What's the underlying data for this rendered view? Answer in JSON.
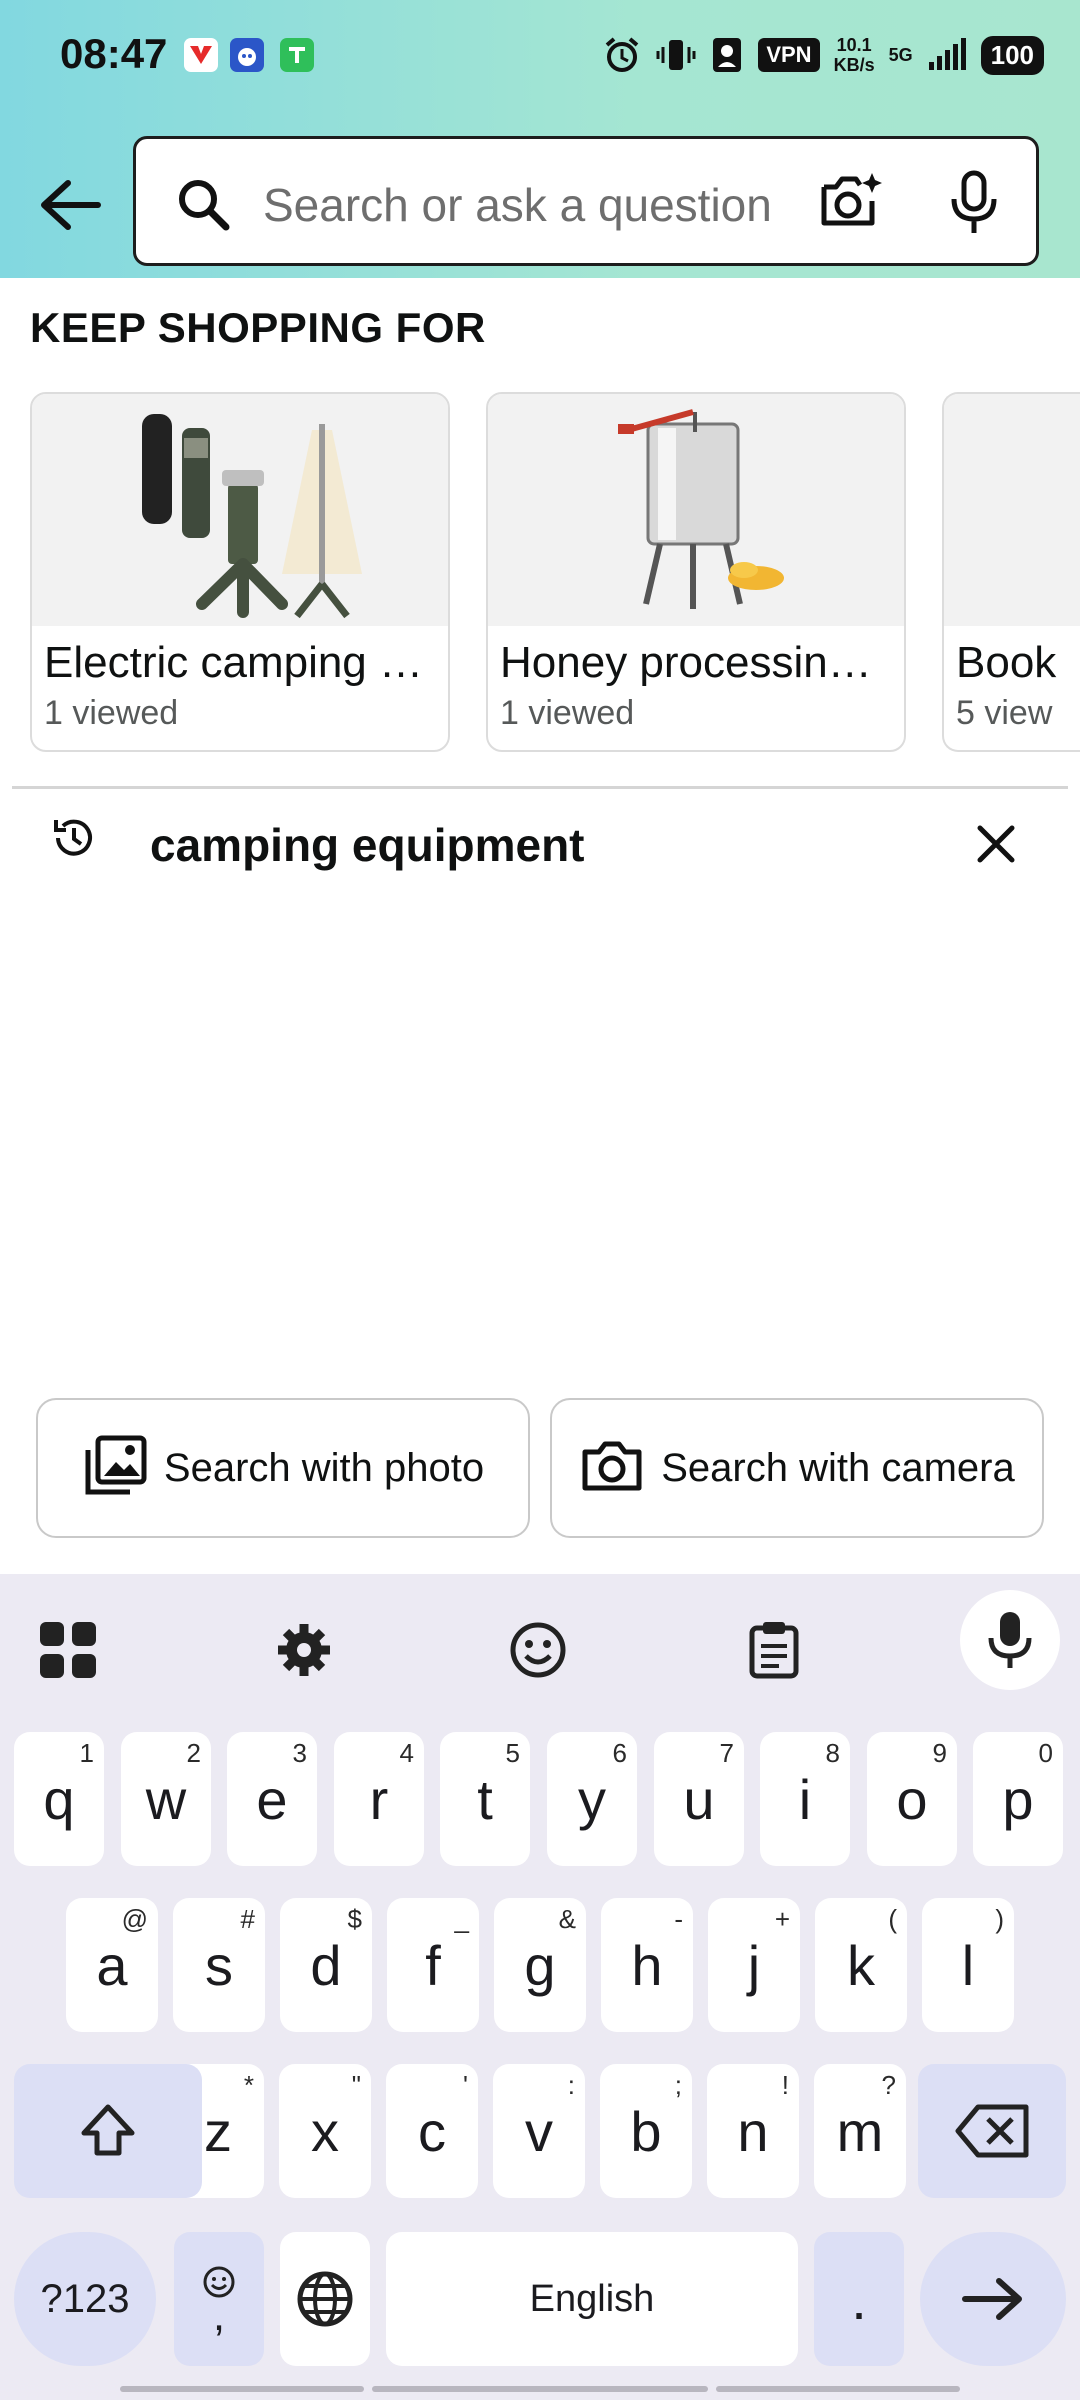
{
  "status_bar": {
    "time": "08:47",
    "vpn": "VPN",
    "speed_value": "10.1",
    "speed_unit": "KB/s",
    "network": "5G",
    "battery": "100",
    "icons": [
      "alarm-icon",
      "vibrate-icon",
      "profile-icon",
      "signal-icon"
    ]
  },
  "search": {
    "placeholder": "Search or ask a question",
    "value": ""
  },
  "keep_shopping": {
    "title": "KEEP SHOPPING FOR",
    "cards": [
      {
        "title": "Electric camping …",
        "subtitle": "1 viewed"
      },
      {
        "title": "Honey processin…",
        "subtitle": "1 viewed"
      },
      {
        "title": "Book",
        "subtitle": "5 view"
      }
    ]
  },
  "history": {
    "items": [
      {
        "text": "camping equipment"
      }
    ]
  },
  "actions": {
    "photo_label": "Search with photo",
    "camera_label": "Search with camera"
  },
  "keyboard": {
    "row1": [
      {
        "k": "q",
        "h": "1"
      },
      {
        "k": "w",
        "h": "2"
      },
      {
        "k": "e",
        "h": "3"
      },
      {
        "k": "r",
        "h": "4"
      },
      {
        "k": "t",
        "h": "5"
      },
      {
        "k": "y",
        "h": "6"
      },
      {
        "k": "u",
        "h": "7"
      },
      {
        "k": "i",
        "h": "8"
      },
      {
        "k": "o",
        "h": "9"
      },
      {
        "k": "p",
        "h": "0"
      }
    ],
    "row2": [
      {
        "k": "a",
        "h": "@"
      },
      {
        "k": "s",
        "h": "#"
      },
      {
        "k": "d",
        "h": "$"
      },
      {
        "k": "f",
        "h": "_"
      },
      {
        "k": "g",
        "h": "&"
      },
      {
        "k": "h",
        "h": "-"
      },
      {
        "k": "j",
        "h": "+"
      },
      {
        "k": "k",
        "h": "("
      },
      {
        "k": "l",
        "h": ")"
      }
    ],
    "row3": [
      {
        "k": "z",
        "h": "*"
      },
      {
        "k": "x",
        "h": "\""
      },
      {
        "k": "c",
        "h": "'"
      },
      {
        "k": "v",
        "h": ":"
      },
      {
        "k": "b",
        "h": ";"
      },
      {
        "k": "n",
        "h": "!"
      },
      {
        "k": "m",
        "h": "?"
      }
    ],
    "numbers_label": "?123",
    "comma_label": ",",
    "space_label": "English",
    "period_label": "."
  }
}
